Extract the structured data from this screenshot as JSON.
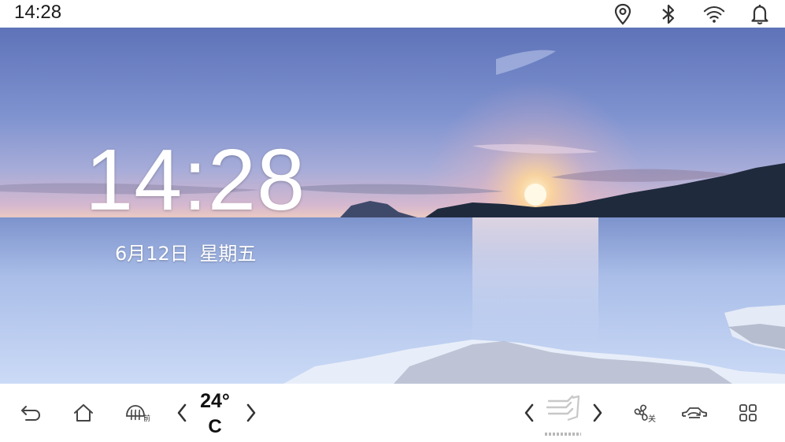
{
  "status_bar": {
    "time": "14:28",
    "icons": [
      "location-icon",
      "bluetooth-icon",
      "wifi-icon",
      "notification-bell-icon"
    ]
  },
  "lockscreen": {
    "clock": "14:28",
    "date": "6月12日 星期五"
  },
  "dock": {
    "left_buttons": [
      "back-icon",
      "home-icon",
      "front-defrost-icon"
    ],
    "defrost_label": "前",
    "temperature": {
      "value": "24°",
      "unit": "C"
    },
    "right_buttons": [
      "airflow-mode-icon",
      "fan-icon",
      "car-recirculation-icon",
      "app-grid-icon"
    ],
    "fan_label": "关"
  },
  "colors": {
    "icon": "#444444",
    "status_icon": "#333333",
    "text": "#111111",
    "background": "#ffffff"
  }
}
